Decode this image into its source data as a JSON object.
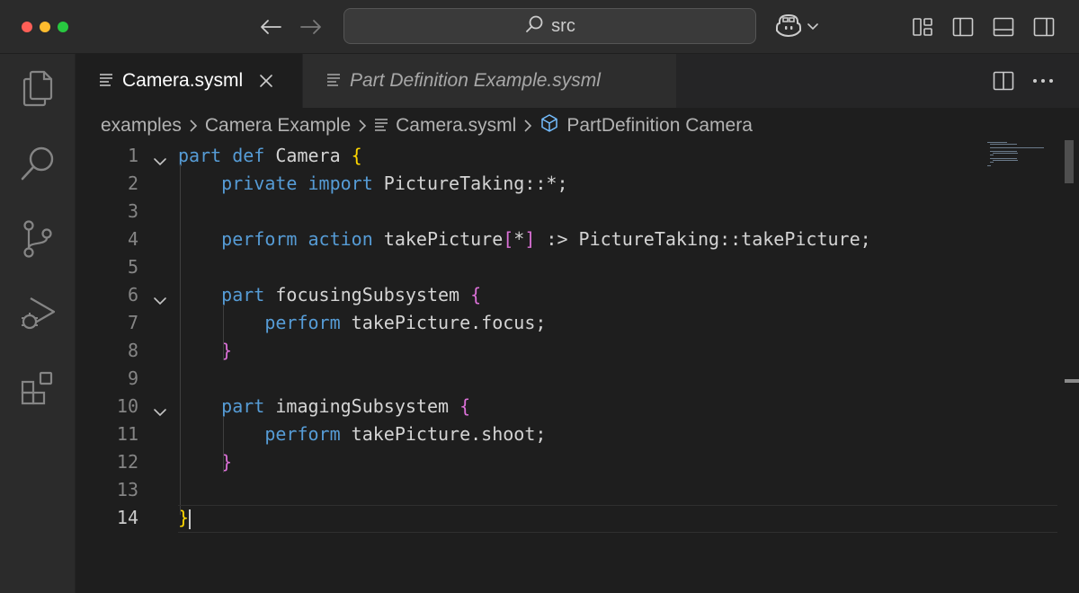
{
  "titlebar": {
    "search_text": "src",
    "icons": [
      "arrow-left-icon",
      "arrow-right-icon",
      "search-icon",
      "copilot-icon",
      "layout-customize-icon",
      "toggle-sidebar-icon",
      "toggle-panel-icon",
      "toggle-secondary-sidebar-icon"
    ]
  },
  "activitybar": {
    "items": [
      "explorer-icon",
      "search-icon",
      "source-control-icon",
      "run-debug-icon",
      "extensions-icon"
    ]
  },
  "tabs": [
    {
      "label": "Camera.sysml",
      "active": true
    },
    {
      "label": "Part Definition Example.sysml",
      "active": false
    }
  ],
  "breadcrumb": {
    "items": [
      "examples",
      "Camera Example",
      "Camera.sysml",
      "PartDefinition Camera"
    ]
  },
  "editor": {
    "current_line": "14",
    "lines": [
      {
        "n": "1",
        "parts": [
          {
            "t": "part def",
            "c": "kw"
          },
          {
            "t": " Camera "
          },
          {
            "t": "{",
            "c": "br1"
          }
        ]
      },
      {
        "n": "2",
        "parts": [
          {
            "t": "    "
          },
          {
            "t": "private import",
            "c": "kw"
          },
          {
            "t": " PictureTaking::*;"
          }
        ]
      },
      {
        "n": "3",
        "parts": []
      },
      {
        "n": "4",
        "parts": [
          {
            "t": "    "
          },
          {
            "t": "perform action",
            "c": "kw"
          },
          {
            "t": " takePicture"
          },
          {
            "t": "[",
            "c": "br2"
          },
          {
            "t": "*"
          },
          {
            "t": "]",
            "c": "br2"
          },
          {
            "t": " :> PictureTaking::takePicture;"
          }
        ]
      },
      {
        "n": "5",
        "parts": []
      },
      {
        "n": "6",
        "parts": [
          {
            "t": "    "
          },
          {
            "t": "part",
            "c": "kw"
          },
          {
            "t": " focusingSubsystem "
          },
          {
            "t": "{",
            "c": "br2"
          }
        ]
      },
      {
        "n": "7",
        "parts": [
          {
            "t": "        "
          },
          {
            "t": "perform",
            "c": "kw"
          },
          {
            "t": " takePicture.focus;"
          }
        ]
      },
      {
        "n": "8",
        "parts": [
          {
            "t": "    "
          },
          {
            "t": "}",
            "c": "br2"
          }
        ]
      },
      {
        "n": "9",
        "parts": []
      },
      {
        "n": "10",
        "parts": [
          {
            "t": "    "
          },
          {
            "t": "part",
            "c": "kw"
          },
          {
            "t": " imagingSubsystem "
          },
          {
            "t": "{",
            "c": "br2"
          }
        ]
      },
      {
        "n": "11",
        "parts": [
          {
            "t": "        "
          },
          {
            "t": "perform",
            "c": "kw"
          },
          {
            "t": " takePicture.shoot;"
          }
        ]
      },
      {
        "n": "12",
        "parts": [
          {
            "t": "    "
          },
          {
            "t": "}",
            "c": "br2"
          }
        ]
      },
      {
        "n": "13",
        "parts": []
      },
      {
        "n": "14",
        "parts": [
          {
            "t": "}",
            "c": "br1"
          }
        ]
      }
    ],
    "folded_lines": [
      "1",
      "6",
      "10"
    ]
  },
  "colors": {
    "keyword": "#569cd6",
    "bracket_level1": "#ffd700",
    "bracket_level2": "#da70d6",
    "text": "#d4d4d4"
  }
}
